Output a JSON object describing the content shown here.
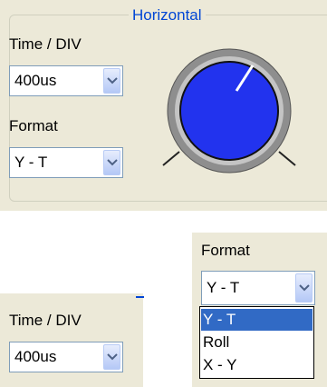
{
  "horizontal": {
    "title": "Horizontal",
    "time_div_label": "Time / DIV",
    "time_div_value": "400us",
    "format_label": "Format",
    "format_value": "Y - T"
  },
  "format_popup": {
    "label": "Format",
    "value": "Y - T",
    "options": [
      "Y - T",
      "Roll",
      "X - Y"
    ],
    "selected_index": 0
  },
  "time_div_closeup": {
    "label": "Time / DIV",
    "value": "400us"
  },
  "colors": {
    "group_title": "#0046d5",
    "knob_fill": "#2233ee",
    "selection": "#316ac5",
    "panel": "#ece9d8"
  }
}
